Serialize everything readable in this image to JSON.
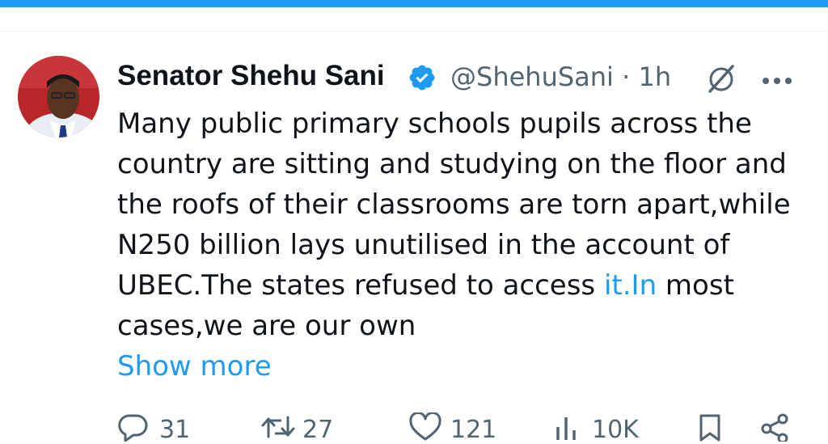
{
  "tweet": {
    "author_name": "Senator Shehu Sani",
    "handle_time": "@ShehuSani · 1h",
    "text_before_link": "Many public primary schools pupils across the\ncountry are sitting and studying on the floor and\nthe roofs of their classrooms are torn apart,while\nN250 billion lays unutilised in the account of\nUBEC.The states refused to access ",
    "link_text": "it.In",
    "text_after_link": " most\ncases,we are our own",
    "show_more": "Show more"
  },
  "actions": {
    "replies": "31",
    "reposts": "27",
    "likes": "121",
    "views": "10K"
  },
  "colors": {
    "accent": "#1d9bf0",
    "text": "#0f1419",
    "secondary": "#536471"
  },
  "icons": [
    "verified-badge-icon",
    "grok-icon",
    "more-options-icon",
    "reply-icon",
    "repost-icon",
    "like-icon",
    "views-icon",
    "bookmark-icon",
    "share-icon"
  ]
}
